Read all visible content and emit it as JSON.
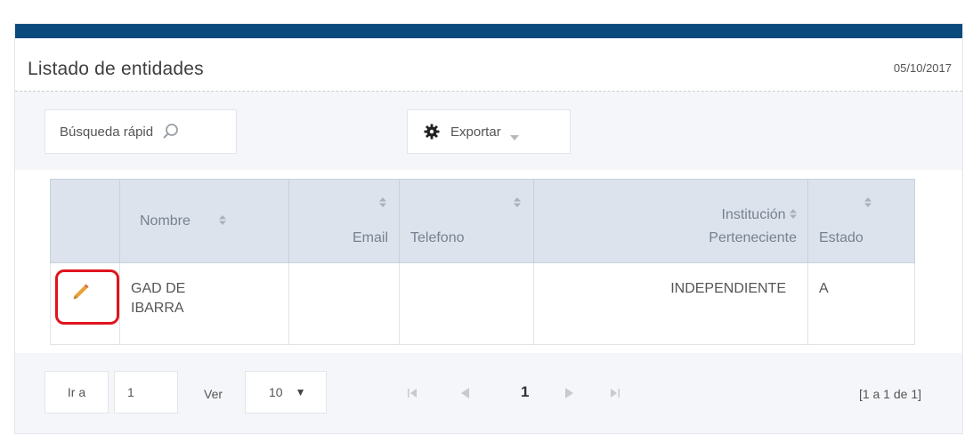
{
  "header": {
    "title": "Listado de entidades",
    "date": "05/10/2017"
  },
  "toolbar": {
    "search_placeholder": "Búsqueda rápid",
    "export_label": "Exportar"
  },
  "table": {
    "columns": [
      "",
      "Nombre",
      "Email",
      "Telefono",
      "Institución",
      "Perteneciente",
      "Estado"
    ],
    "rows": [
      {
        "nombre_line1": "GAD DE",
        "nombre_line2": "IBARRA",
        "email": "",
        "telefono": "",
        "institucion": "INDEPENDIENTE",
        "estado": "A"
      }
    ]
  },
  "pager": {
    "goto_label": "Ir a",
    "page_value": "1",
    "ver_label": "Ver",
    "page_size": "10",
    "current_page": "1",
    "range_text": "[1 a 1 de 1]"
  },
  "colors": {
    "topbar": "#0b4a7d",
    "header_bg": "#dce3ec",
    "highlight": "#e0141e",
    "pencil": "#e8a13a"
  },
  "icons": [
    "search-icon",
    "gear-icon",
    "caret-down-icon",
    "sort-icon",
    "pencil-icon",
    "first-page-icon",
    "prev-page-icon",
    "next-page-icon",
    "last-page-icon"
  ]
}
